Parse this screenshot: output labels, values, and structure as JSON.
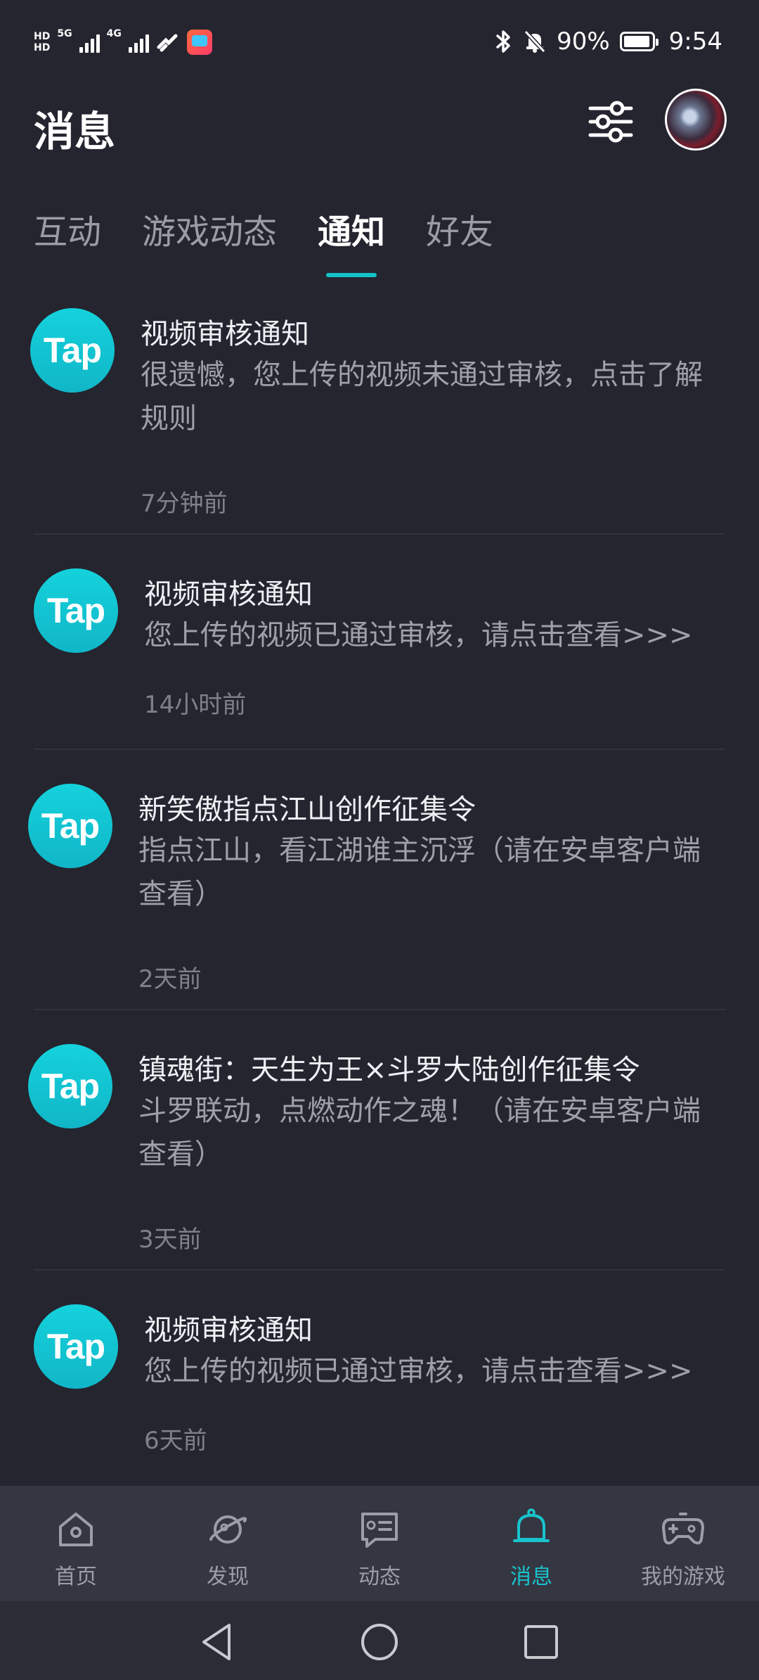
{
  "status_bar": {
    "hd_top": "HD",
    "hd_bottom": "HD",
    "net1": "5G",
    "net2": "4G",
    "battery_text": "90%",
    "time": "9:54"
  },
  "header": {
    "title": "消息"
  },
  "tabs": [
    {
      "label": "互动"
    },
    {
      "label": "游戏动态"
    },
    {
      "label": "通知",
      "active": true
    },
    {
      "label": "好友"
    }
  ],
  "notifications": [
    {
      "logo_text": "Tap",
      "title": "视频审核通知",
      "body": "很遗憾，您上传的视频未通过审核，点击了解规则",
      "time": "7分钟前"
    },
    {
      "logo_text": "Tap",
      "title": "视频审核通知",
      "body": "您上传的视频已通过审核，请点击查看>>>",
      "time": "14小时前"
    },
    {
      "logo_text": "Tap",
      "title": "新笑傲指点江山创作征集令",
      "body": "指点江山，看江湖谁主沉浮（请在安卓客户端查看）",
      "time": "2天前"
    },
    {
      "logo_text": "Tap",
      "title": "镇魂街：天生为王×斗罗大陆创作征集令",
      "body": "斗罗联动，点燃动作之魂！（请在安卓客户端查看）",
      "time": "3天前"
    },
    {
      "logo_text": "Tap",
      "title": "视频审核通知",
      "body": "您上传的视频已通过审核，请点击查看>>>",
      "time": "6天前"
    }
  ],
  "bottom_nav": [
    {
      "label": "首页",
      "icon": "home-icon"
    },
    {
      "label": "发现",
      "icon": "discover-planet-icon"
    },
    {
      "label": "动态",
      "icon": "feed-card-icon"
    },
    {
      "label": "消息",
      "icon": "bell-icon",
      "active": true
    },
    {
      "label": "我的游戏",
      "icon": "gamepad-icon"
    }
  ],
  "colors": {
    "background": "#24252f",
    "accent": "#14c1c9",
    "nav_background": "#343642"
  }
}
